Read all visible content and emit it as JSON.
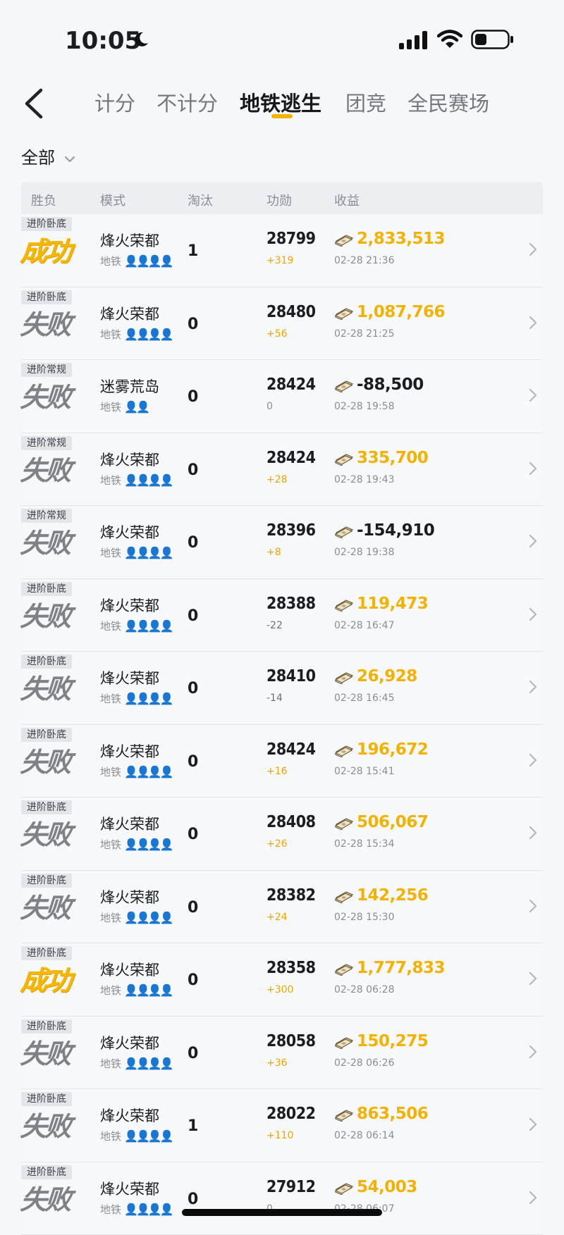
{
  "status": {
    "time": "10:05"
  },
  "nav": {
    "tabs": [
      {
        "label": "计分",
        "active": false
      },
      {
        "label": "不计分",
        "active": false
      },
      {
        "label": "地铁逃生",
        "active": true
      },
      {
        "label": "团竞",
        "active": false
      },
      {
        "label": "全民赛场",
        "active": false
      }
    ]
  },
  "filter": {
    "label": "全部"
  },
  "table": {
    "headers": [
      "胜负",
      "模式",
      "淘汰",
      "功勋",
      "收益"
    ],
    "rows": [
      {
        "tag": "进阶卧底",
        "result": "成功",
        "win": true,
        "mode": "烽火荣都",
        "sub": "地铁",
        "people": "👤👤👤👤",
        "elim": "1",
        "merit": "28799",
        "delta": "+319",
        "earnings": "2,833,513",
        "earn_positive": true,
        "time": "02-28 21:36"
      },
      {
        "tag": "进阶卧底",
        "result": "失败",
        "win": false,
        "mode": "烽火荣都",
        "sub": "地铁",
        "people": "👤👤👤👤",
        "elim": "0",
        "merit": "28480",
        "delta": "+56",
        "earnings": "1,087,766",
        "earn_positive": true,
        "time": "02-28 21:25"
      },
      {
        "tag": "进阶常规",
        "result": "失败",
        "win": false,
        "mode": "迷雾荒岛",
        "sub": "地铁",
        "people": "👤👤",
        "elim": "0",
        "merit": "28424",
        "delta": "0",
        "earnings": "-88,500",
        "earn_positive": false,
        "time": "02-28 19:58"
      },
      {
        "tag": "进阶常规",
        "result": "失败",
        "win": false,
        "mode": "烽火荣都",
        "sub": "地铁",
        "people": "👤👤👤👤",
        "elim": "0",
        "merit": "28424",
        "delta": "+28",
        "earnings": "335,700",
        "earn_positive": true,
        "time": "02-28 19:43"
      },
      {
        "tag": "进阶常规",
        "result": "失败",
        "win": false,
        "mode": "烽火荣都",
        "sub": "地铁",
        "people": "👤👤👤👤",
        "elim": "0",
        "merit": "28396",
        "delta": "+8",
        "earnings": "-154,910",
        "earn_positive": false,
        "time": "02-28 19:38"
      },
      {
        "tag": "进阶卧底",
        "result": "失败",
        "win": false,
        "mode": "烽火荣都",
        "sub": "地铁",
        "people": "👤👤👤👤",
        "elim": "0",
        "merit": "28388",
        "delta": "-22",
        "earnings": "119,473",
        "earn_positive": true,
        "time": "02-28 16:47"
      },
      {
        "tag": "进阶卧底",
        "result": "失败",
        "win": false,
        "mode": "烽火荣都",
        "sub": "地铁",
        "people": "👤👤👤👤",
        "elim": "0",
        "merit": "28410",
        "delta": "-14",
        "earnings": "26,928",
        "earn_positive": true,
        "time": "02-28 16:45"
      },
      {
        "tag": "进阶卧底",
        "result": "失败",
        "win": false,
        "mode": "烽火荣都",
        "sub": "地铁",
        "people": "👤👤👤👤",
        "elim": "0",
        "merit": "28424",
        "delta": "+16",
        "earnings": "196,672",
        "earn_positive": true,
        "time": "02-28 15:41"
      },
      {
        "tag": "进阶卧底",
        "result": "失败",
        "win": false,
        "mode": "烽火荣都",
        "sub": "地铁",
        "people": "👤👤👤👤",
        "elim": "0",
        "merit": "28408",
        "delta": "+26",
        "earnings": "506,067",
        "earn_positive": true,
        "time": "02-28 15:34"
      },
      {
        "tag": "进阶卧底",
        "result": "失败",
        "win": false,
        "mode": "烽火荣都",
        "sub": "地铁",
        "people": "👤👤👤👤",
        "elim": "0",
        "merit": "28382",
        "delta": "+24",
        "earnings": "142,256",
        "earn_positive": true,
        "time": "02-28 15:30"
      },
      {
        "tag": "进阶卧底",
        "result": "成功",
        "win": true,
        "mode": "烽火荣都",
        "sub": "地铁",
        "people": "👤👤👤👤",
        "elim": "0",
        "merit": "28358",
        "delta": "+300",
        "earnings": "1,777,833",
        "earn_positive": true,
        "time": "02-28 06:28"
      },
      {
        "tag": "进阶卧底",
        "result": "失败",
        "win": false,
        "mode": "烽火荣都",
        "sub": "地铁",
        "people": "👤👤👤👤",
        "elim": "0",
        "merit": "28058",
        "delta": "+36",
        "earnings": "150,275",
        "earn_positive": true,
        "time": "02-28 06:26"
      },
      {
        "tag": "进阶卧底",
        "result": "失败",
        "win": false,
        "mode": "烽火荣都",
        "sub": "地铁",
        "people": "👤👤👤👤",
        "elim": "1",
        "merit": "28022",
        "delta": "+110",
        "earnings": "863,506",
        "earn_positive": true,
        "time": "02-28 06:14"
      },
      {
        "tag": "进阶卧底",
        "result": "失败",
        "win": false,
        "mode": "烽火荣都",
        "sub": "地铁",
        "people": "👤👤👤👤",
        "elim": "0",
        "merit": "27912",
        "delta": "0",
        "earnings": "54,003",
        "earn_positive": true,
        "time": "02-28 06:07"
      }
    ]
  },
  "colors": {
    "accent": "#f4b300",
    "win": "#f5b800",
    "lose": "#7e8287",
    "earn_positive": "#f3b100"
  }
}
